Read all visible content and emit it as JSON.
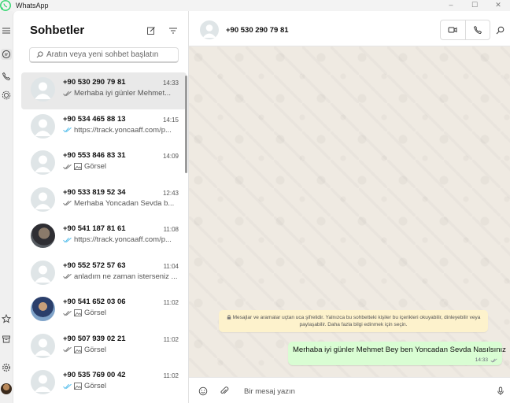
{
  "window": {
    "title": "WhatsApp",
    "minimize": "–",
    "maximize": "☐",
    "close": "✕"
  },
  "sidebar_rail": {
    "icons": [
      "menu-icon",
      "chats-icon",
      "calls-icon",
      "status-icon",
      "starred-icon",
      "archive-icon",
      "settings-icon",
      "profile-avatar"
    ]
  },
  "chat_list": {
    "title": "Sohbetler",
    "search_placeholder": "Aratın veya yeni sohbet başlatın",
    "chats": [
      {
        "name": "+90 530 290 79 81",
        "time": "14:33",
        "preview": "Merhaba iyi günler Mehmet...",
        "tick": "gray",
        "image": false
      },
      {
        "name": "+90 534 465 88 13",
        "time": "14:15",
        "preview": "https://track.yoncaaff.com/p...",
        "tick": "blue",
        "image": false
      },
      {
        "name": "+90 553 846 83 31",
        "time": "14:09",
        "preview": "Görsel",
        "tick": "gray",
        "image": true
      },
      {
        "name": "+90 533 819 52 34",
        "time": "12:43",
        "preview": "Merhaba Yoncadan Sevda b...",
        "tick": "gray",
        "image": false
      },
      {
        "name": "+90 541 187 81 61",
        "time": "11:08",
        "preview": "https://track.yoncaaff.com/p...",
        "tick": "blue",
        "image": false
      },
      {
        "name": "+90 552 572 57 63",
        "time": "11:04",
        "preview": "anladım ne zaman isterseniz ...",
        "tick": "gray",
        "image": false
      },
      {
        "name": "+90 541 652 03 06",
        "time": "11:02",
        "preview": "Görsel",
        "tick": "gray",
        "image": true
      },
      {
        "name": "+90 507 939 02 21",
        "time": "11:02",
        "preview": "Görsel",
        "tick": "gray",
        "image": true
      },
      {
        "name": "+90 535 769 00 42",
        "time": "11:02",
        "preview": "Görsel",
        "tick": "blue",
        "image": true
      }
    ]
  },
  "conversation": {
    "contact_name": "+90 530 290 79 81",
    "encryption_notice": "Mesajlar ve aramalar uçtan uca şifrelidir. Yalnızca bu sohbetteki kişiler bu içerikleri okuyabilir, dinleyebilir veya paylaşabilir. Daha fazla bilgi edinmek için seçin.",
    "messages": [
      {
        "text": "Merhaba iyi günler Mehmet Bey ben Yoncadan Sevda Nasılsınız",
        "time": "14:33",
        "direction": "outgoing",
        "tick": "gray"
      }
    ],
    "composer_placeholder": "Bir mesaj yazın"
  },
  "colors": {
    "accent": "#25d366",
    "bubble_out": "#d9fdd3",
    "tick_blue": "#53bdeb",
    "notice_bg": "#fdf2cc",
    "wallpaper": "#efeae2"
  }
}
